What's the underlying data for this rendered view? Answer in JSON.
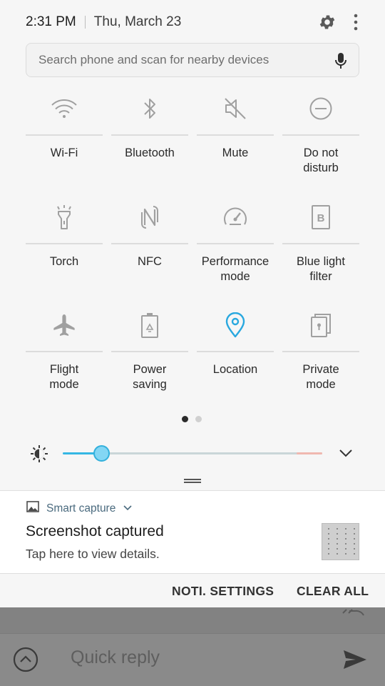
{
  "status": {
    "time": "2:31 PM",
    "date": "Thu, March 23"
  },
  "search": {
    "placeholder": "Search phone and scan for nearby devices"
  },
  "toggles": [
    {
      "label": "Wi-Fi",
      "icon": "wifi-icon"
    },
    {
      "label": "Bluetooth",
      "icon": "bluetooth-icon"
    },
    {
      "label": "Mute",
      "icon": "mute-icon"
    },
    {
      "label": "Do not\ndisturb",
      "icon": "do-not-disturb-icon"
    },
    {
      "label": "Torch",
      "icon": "torch-icon"
    },
    {
      "label": "NFC",
      "icon": "nfc-icon"
    },
    {
      "label": "Performance\nmode",
      "icon": "performance-icon"
    },
    {
      "label": "Blue light\nfilter",
      "icon": "blue-light-filter-icon"
    },
    {
      "label": "Flight\nmode",
      "icon": "airplane-icon"
    },
    {
      "label": "Power\nsaving",
      "icon": "battery-recycle-icon"
    },
    {
      "label": "Location",
      "icon": "location-pin-icon",
      "active": true
    },
    {
      "label": "Private\nmode",
      "icon": "private-mode-icon"
    }
  ],
  "pager": {
    "pages": 2,
    "current": 1
  },
  "brightness": {
    "level": 0.15
  },
  "colors": {
    "accent": "#35b7e4",
    "thumb": "#83d6f4",
    "icon": "#9a9a9a",
    "active_icon": "#29a8df"
  },
  "notification": {
    "app": "Smart capture",
    "title": "Screenshot captured",
    "text": "Tap here to view details."
  },
  "actions": {
    "settings": "NOTI. SETTINGS",
    "clear": "CLEAR ALL"
  },
  "background_app": {
    "quick_reply_placeholder": "Quick reply"
  }
}
